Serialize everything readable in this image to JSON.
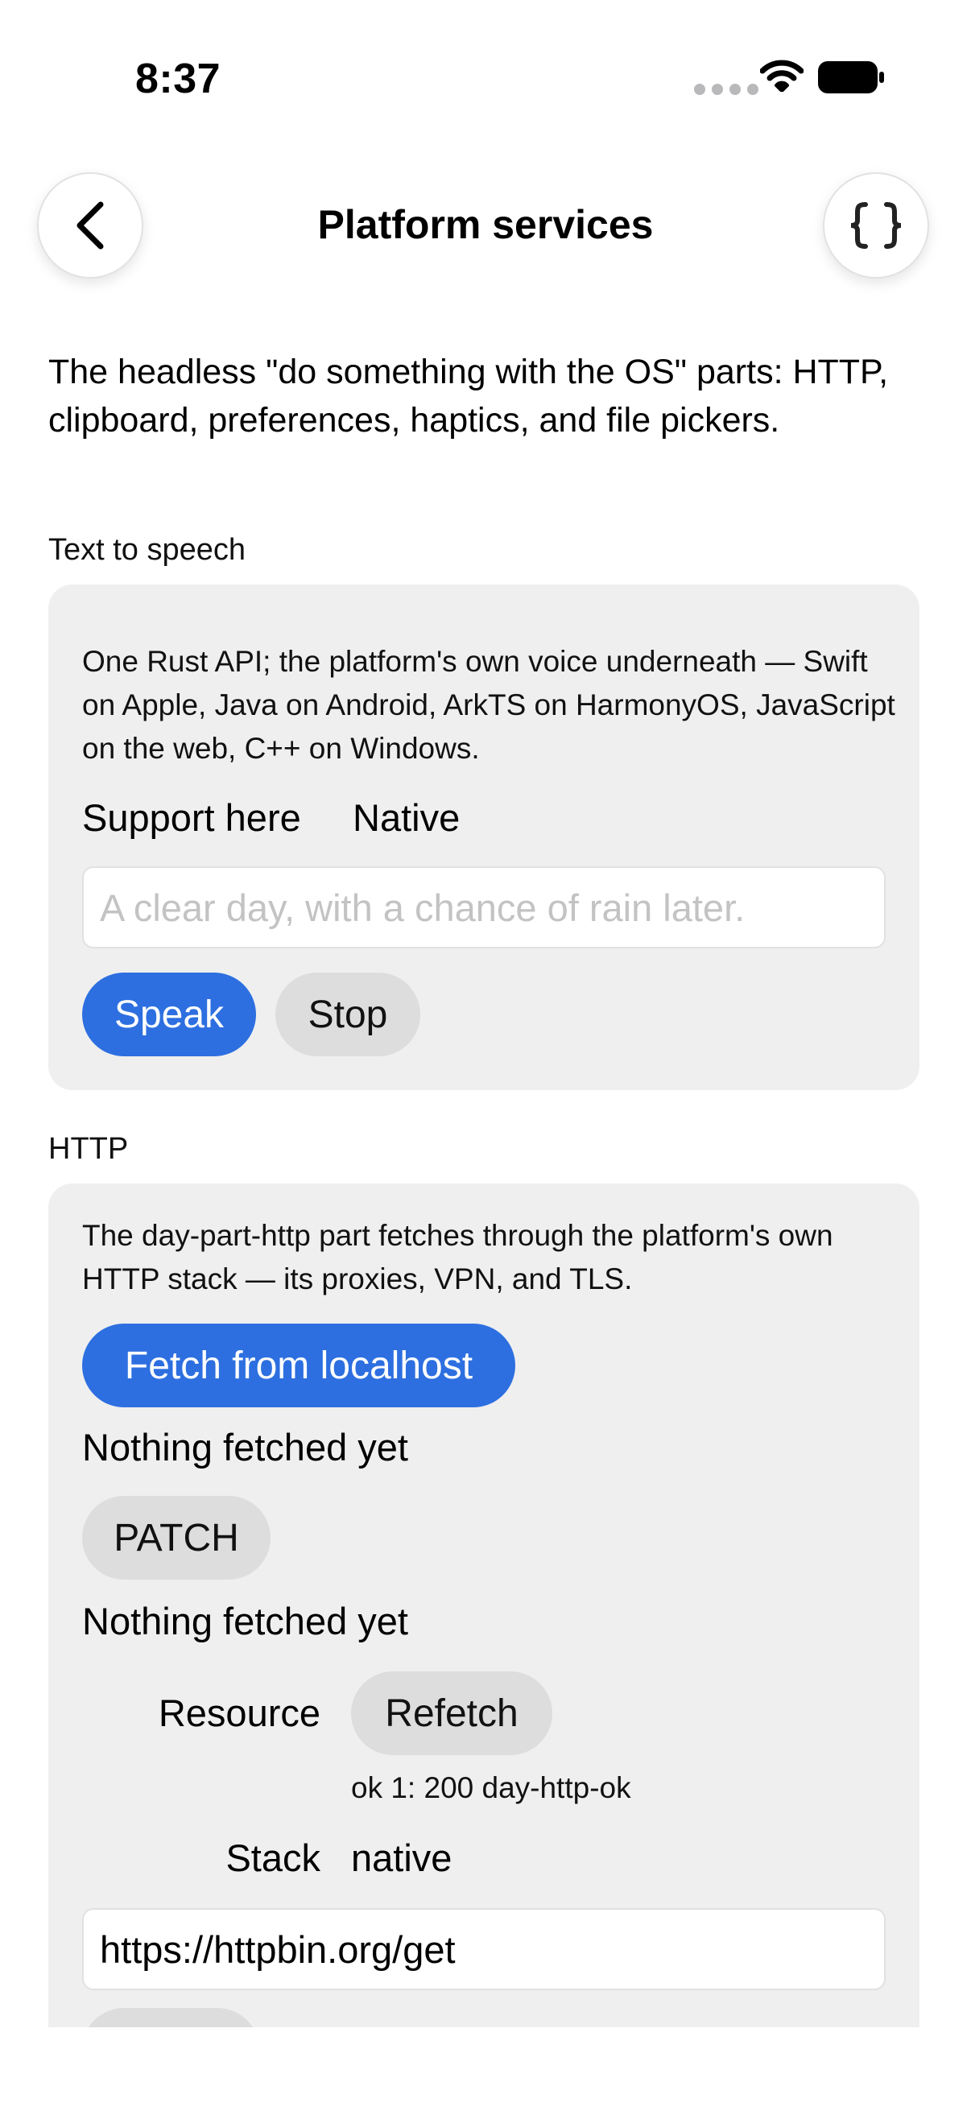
{
  "status_bar": {
    "time": "8:37"
  },
  "nav": {
    "title": "Platform services"
  },
  "intro": "The headless \"do something with the OS\" parts: HTTP, clipboard, preferences, haptics, and file pickers.",
  "tts": {
    "section_label": "Text to speech",
    "description": "One Rust API; the platform's own voice underneath — Swift on Apple, Java on Android, ArkTS on HarmonyOS, JavaScript on the web, C++ on Windows.",
    "support_label": "Support here",
    "support_value": "Native",
    "input_placeholder": "A clear day, with a chance of rain later.",
    "speak_label": "Speak",
    "stop_label": "Stop"
  },
  "http": {
    "section_label": "HTTP",
    "description": "The day-part-http part fetches through the platform's own HTTP stack — its proxies, VPN, and TLS.",
    "fetch_label": "Fetch from localhost",
    "fetch_status": "Nothing fetched yet",
    "patch_label": "PATCH",
    "patch_status": "Nothing fetched yet",
    "resource_label": "Resource",
    "refetch_label": "Refetch",
    "resource_status": "ok 1: 200 day-http-ok",
    "stack_label": "Stack",
    "stack_value": "native",
    "url_value": "https://httpbin.org/get"
  },
  "colors": {
    "accent": "#2d6fe0",
    "card_bg": "#efefef",
    "secondary_button": "#dddddd"
  },
  "icons": [
    "chevron-left-icon",
    "braces-icon",
    "cellular-signal-icon",
    "wifi-icon",
    "battery-icon"
  ]
}
